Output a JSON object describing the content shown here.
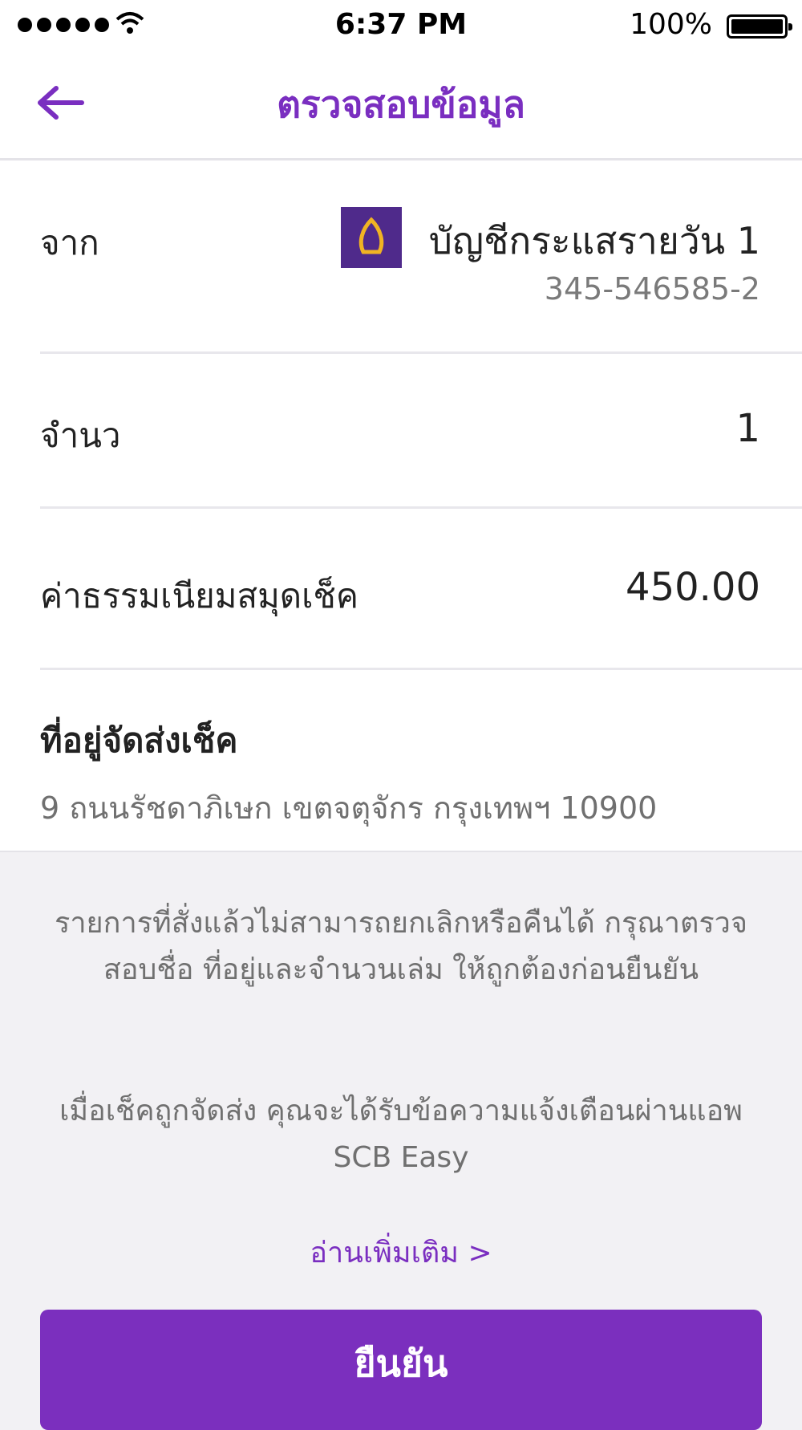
{
  "status_bar": {
    "time": "6:37 PM",
    "battery": "100%"
  },
  "header": {
    "title": "ตรวจสอบข้อมูล"
  },
  "from": {
    "label": "จาก",
    "account_name": "บัญชีกระแสรายวัน 1",
    "account_number": "345-546585-2"
  },
  "quantity": {
    "label": "จำนว",
    "value": "1"
  },
  "fee": {
    "label": "ค่าธรรมเนียมสมุดเช็ค",
    "value": "450.00"
  },
  "address": {
    "label": "ที่อยู่จัดส่งเช็ค",
    "value": "9 ถนนรัชดาภิเษก เขตจตุจักร กรุงเทพฯ 10900"
  },
  "notes": {
    "warning": "รายการที่สั่งแล้วไม่สามารถยกเลิกหรือคืนได้ กรุณาตรวจสอบชื่อ ที่อยู่และจำนวนเล่ม ให้ถูกต้องก่อนยืนยัน",
    "notification": "เมื่อเช็คถูกจัดส่ง คุณจะได้รับข้อความแจ้งเตือนผ่านแอพ SCB Easy"
  },
  "read_more": "อ่านเพิ่มเติม >",
  "confirm_button": "ยืนยัน",
  "colors": {
    "accent": "#7b2fbe",
    "logo_bg": "#4f2a8b",
    "logo_icon": "#f0b323"
  }
}
